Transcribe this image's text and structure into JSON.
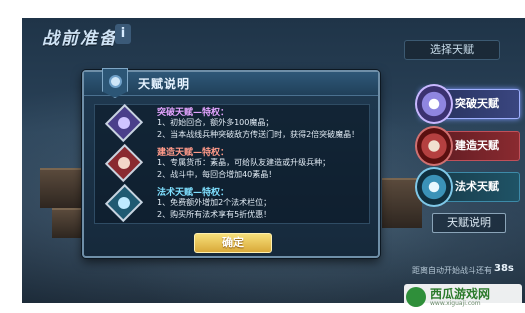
{
  "screen": {
    "title": "战前准备",
    "info_label": "i"
  },
  "right_panel": {
    "header": "选择天赋",
    "talents": [
      {
        "label": "突破天赋",
        "icon": "breakthrough-emblem",
        "color": "#3a4680"
      },
      {
        "label": "建造天赋",
        "icon": "tower-emblem",
        "color": "#8a2a30"
      },
      {
        "label": "法术天赋",
        "icon": "spell-emblem",
        "color": "#1f5366"
      }
    ],
    "explain_button": "天赋说明",
    "auto_start_text": "距离自动开始战斗还有",
    "countdown": "38s"
  },
  "dialog": {
    "title": "天赋说明",
    "rows": [
      {
        "heading": "突破天赋—特权：",
        "lines": [
          "1、初始回合，额外多100魔晶；",
          "2、当本战线兵种突破敌方传送门时，获得2倍突破魔晶！"
        ],
        "icon": "breakthrough-icon",
        "accent": "#e4a4ff"
      },
      {
        "heading": "建造天赋—特权：",
        "lines": [
          "1、专属货币：素晶，可给队友建造或升级兵种；",
          "2、战斗中，每回合增加40素晶！"
        ],
        "icon": "tower-icon",
        "accent": "#ff9a8a"
      },
      {
        "heading": "法术天赋—特权：",
        "lines": [
          "1、免费额外增加2个法术栏位；",
          "2、购买所有法术享有5折优惠！"
        ],
        "icon": "spell-icon",
        "accent": "#7fe0ff"
      }
    ],
    "confirm_label": "确定"
  },
  "watermark": {
    "text": "西瓜游戏网",
    "url": "www.xiguaji.com"
  }
}
